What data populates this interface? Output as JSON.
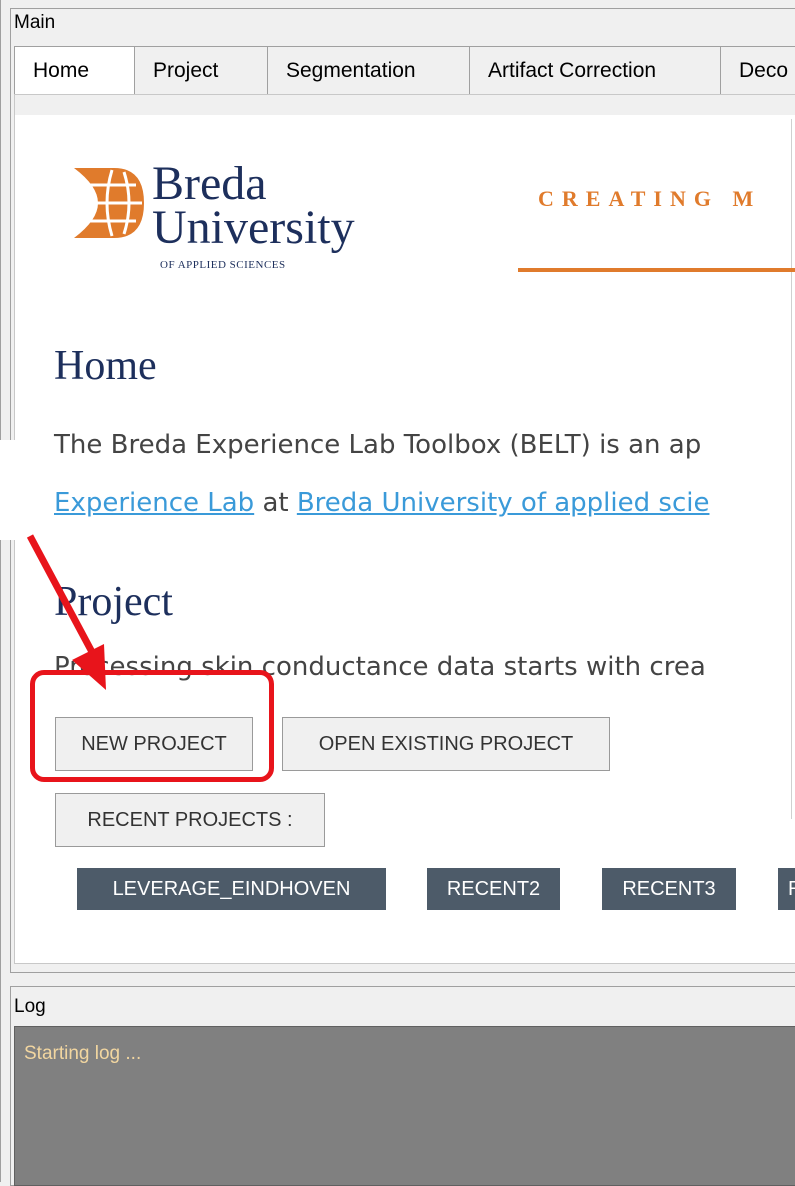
{
  "window": {
    "main_title": "Main",
    "log_title": "Log"
  },
  "tabs": [
    {
      "label": "Home"
    },
    {
      "label": "Project"
    },
    {
      "label": "Segmentation"
    },
    {
      "label": "Artifact Correction"
    },
    {
      "label": "Deco"
    }
  ],
  "logo": {
    "line1": "Breda",
    "line2": "University",
    "line3": "OF APPLIED SCIENCES"
  },
  "tagline": "CREATING M",
  "home": {
    "heading": "Home",
    "para1": "The Breda Experience Lab Toolbox (BELT) is an ap",
    "link1": "Experience Lab",
    "para2_mid": " at ",
    "link2": "Breda University of applied scie"
  },
  "project": {
    "heading": "Project",
    "para": "Processing skin conductance data starts with crea",
    "new_button": "NEW PROJECT",
    "open_button": "OPEN EXISTING PROJECT",
    "recent_label": "RECENT PROJECTS :",
    "recent": [
      "LEVERAGE_EINDHOVEN",
      "RECENT2",
      "RECENT3",
      "R"
    ]
  },
  "log": {
    "text": "Starting log ..."
  },
  "colors": {
    "accent": "#e07b2c",
    "navy": "#1d2f5c",
    "link": "#3a9ad9",
    "annotation": "#e8141b",
    "chip": "#4d5b69"
  }
}
